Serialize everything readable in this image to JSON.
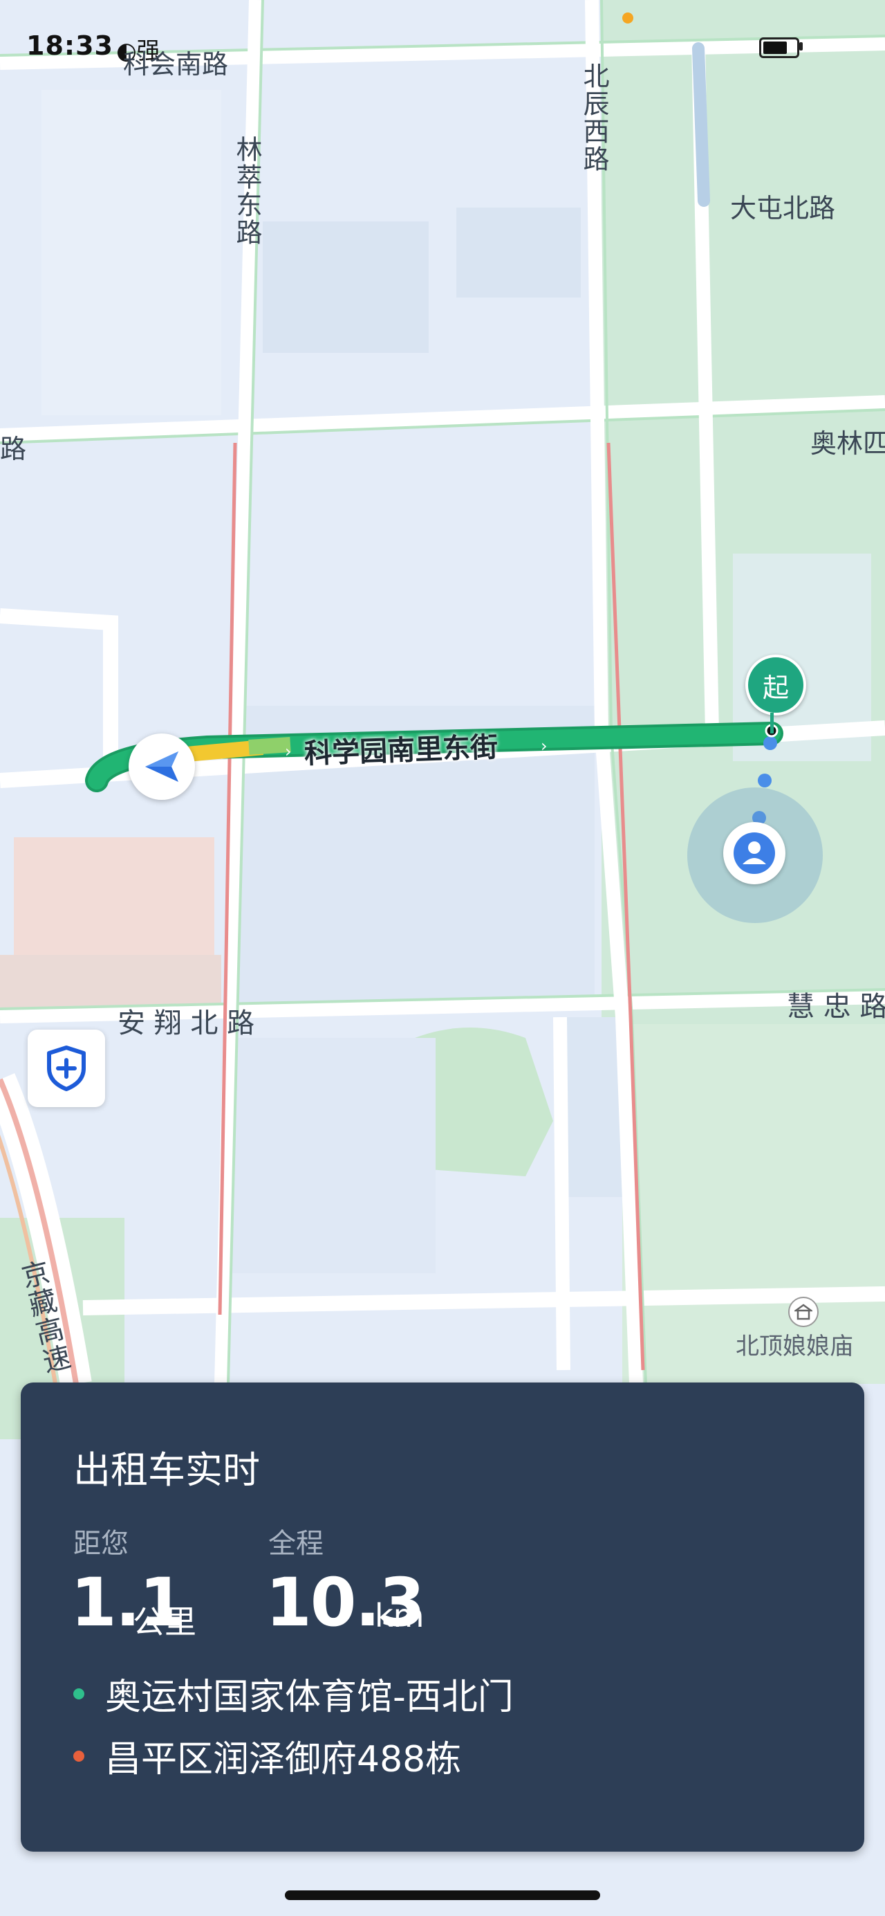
{
  "status_bar": {
    "time": "18:33",
    "signal_text": "强",
    "battery": "battery"
  },
  "map": {
    "roads": {
      "kehui_nan": "科会南路",
      "lincui_dong": "林萃东路",
      "beichen_xi": "北辰西路",
      "datun_bei": "大屯北路",
      "aolin": "奥林匹",
      "left_lu": "路",
      "anxiang_bei": "安 翔 北 路",
      "huizhong": "慧 忠 路",
      "jingzang": "京藏高速"
    },
    "route_street": "科学园南里东街",
    "start_marker": "起",
    "poi": {
      "name": "北顶娘娘庙",
      "icon": "temple-icon"
    }
  },
  "card": {
    "title": "出租车实时",
    "distance_to_you": {
      "label": "距您",
      "value": "1.1",
      "unit": "公里"
    },
    "total": {
      "label": "全程",
      "value": "10.3",
      "unit": "km"
    },
    "pickup": "奥运村国家体育馆-西北门",
    "dropoff": "昌平区润泽御府488栋",
    "colors": {
      "pickup_dot": "#2fbf8c",
      "dropoff_dot": "#e8603c",
      "route": "#21b573",
      "card_bg": "#2d3e56"
    }
  }
}
